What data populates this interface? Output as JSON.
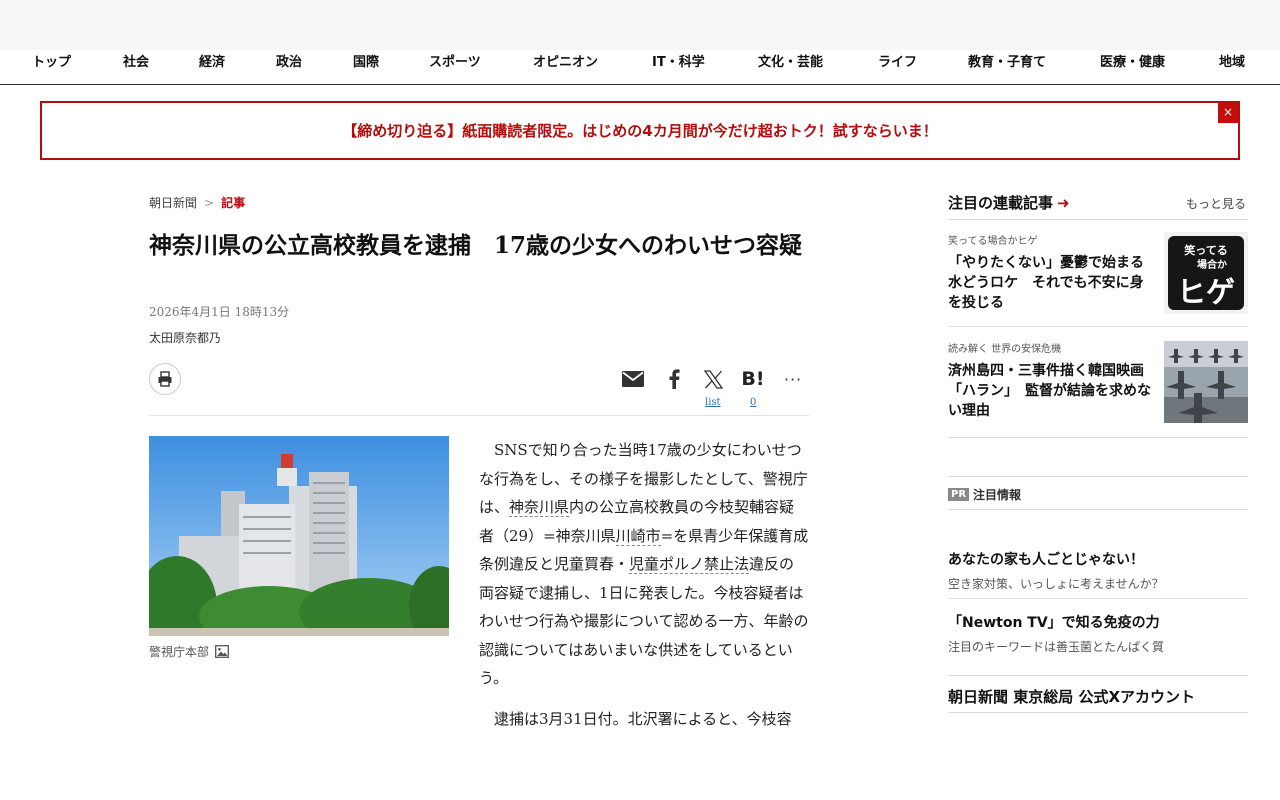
{
  "nav": {
    "items": [
      "トップ",
      "社会",
      "経済",
      "政治",
      "国際",
      "スポーツ",
      "オピニオン",
      "IT・科学",
      "文化・芸能",
      "ライフ",
      "教育・子育て",
      "医療・健康",
      "地域"
    ]
  },
  "promo": {
    "text": "【締め切り迫る】紙面購読者限定。はじめの4カ月間が今だけ超おトク！試すならいま！",
    "close": "×"
  },
  "breadcrumb": {
    "home": "朝日新聞",
    "sep": ">",
    "current": "記事"
  },
  "article": {
    "title": "神奈川県の公立高校教員を逮捕　17歳の少女へのわいせつ容疑",
    "date": "2026年4月1日 18時13分",
    "author": "太田原奈都乃",
    "photo_caption": "警視庁本部",
    "p1": [
      "SNSで知り合った当時17歳の少女にわいせつな行為をし、その様子を撮影したとして、警視庁は、",
      "神奈川県",
      "内の公立高校教員の今枝契輔容疑者（29）=神奈川県",
      "川崎市",
      "=を県青少年保護育成条例違反と児童買春・",
      "児童ポルノ禁止法",
      "違反の両容疑で逮捕し、1日に発表した。今枝容疑者はわいせつ行為や撮影について認める一方、年齢の認識についてはあいまいな供述をしているという。"
    ],
    "p2": "逮捕は3月31日付。北沢署によると、今枝容"
  },
  "share": {
    "x_count": "list",
    "hatena_label": "B!",
    "hatena_count": "0",
    "more": "···"
  },
  "sidebar": {
    "heading": "注目の連載記事",
    "more": "もっと見る",
    "items": [
      {
        "category": "笑ってる場合かヒゲ",
        "title": "「やりたくない」憂鬱で始まる水どうロケ　それでも不安に身を投じる",
        "thumb": {
          "line1": "笑ってる",
          "line2": "場合か",
          "line3": "ヒゲ"
        }
      },
      {
        "category": "読み解く 世界の安保危機",
        "title": "済州島四・三事件描く韓国映画「ハラン」　監督が結論を求めない理由"
      }
    ],
    "pr": {
      "badge": "PR",
      "label": "注目情報",
      "items": [
        {
          "title": "あなたの家も人ごとじゃない！",
          "sub": "空き家対策、いっしょに考えませんか？"
        },
        {
          "title": "「Newton TV」で知る免疫の力",
          "sub": "注目のキーワードは善玉菌とたんぱく質"
        }
      ]
    },
    "bottom": "朝日新聞 東京総局 公式Xアカウント"
  }
}
